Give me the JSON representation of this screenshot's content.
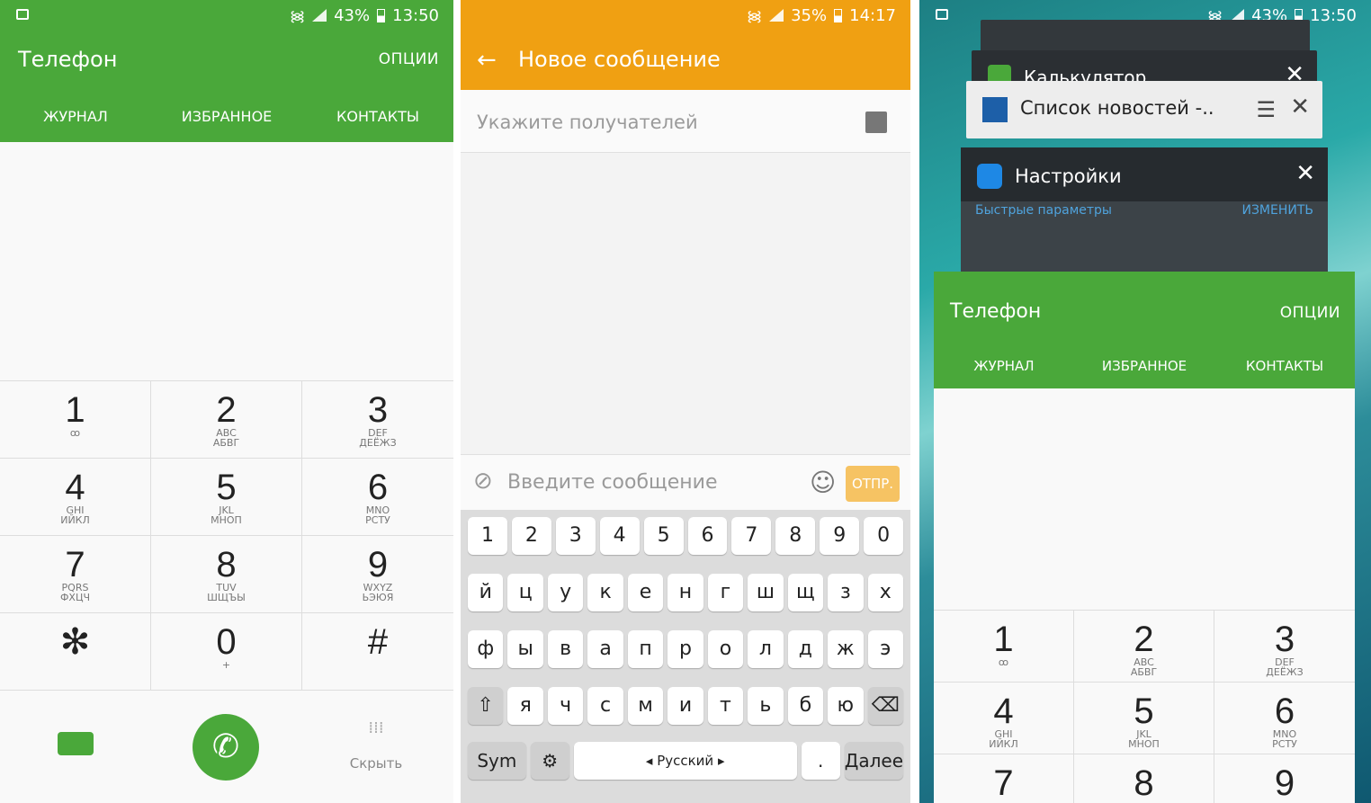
{
  "panel1": {
    "status": {
      "battery": "43%",
      "time": "13:50"
    },
    "title": "Телефон",
    "options": "ОПЦИИ",
    "tabs": [
      "ЖУРНАЛ",
      "ИЗБРАННОЕ",
      "КОНТАКТЫ"
    ],
    "keys": [
      {
        "d": "1",
        "l": "ꝏ"
      },
      {
        "d": "2",
        "l": "ABC\nАБВГ"
      },
      {
        "d": "3",
        "l": "DEF\nДЕЁЖЗ"
      },
      {
        "d": "4",
        "l": "GHI\nИЙКЛ"
      },
      {
        "d": "5",
        "l": "JKL\nМНОП"
      },
      {
        "d": "6",
        "l": "MNO\nРСТУ"
      },
      {
        "d": "7",
        "l": "PQRS\nФХЦЧ"
      },
      {
        "d": "8",
        "l": "TUV\nШЩЪЫ"
      },
      {
        "d": "9",
        "l": "WXYZ\nЬЭЮЯ"
      },
      {
        "d": "✻",
        "l": ""
      },
      {
        "d": "0",
        "l": "+"
      },
      {
        "d": "#",
        "l": ""
      }
    ],
    "hide_label": "Скрыть"
  },
  "panel2": {
    "status": {
      "battery": "35%",
      "time": "14:17"
    },
    "title": "Новое сообщение",
    "recipient_placeholder": "Укажите получателей",
    "message_placeholder": "Введите сообщение",
    "send": "ОТПР.",
    "rows": [
      [
        "1",
        "2",
        "3",
        "4",
        "5",
        "6",
        "7",
        "8",
        "9",
        "0"
      ],
      [
        "й",
        "ц",
        "у",
        "к",
        "е",
        "н",
        "г",
        "ш",
        "щ",
        "з",
        "х"
      ],
      [
        "ф",
        "ы",
        "в",
        "а",
        "п",
        "р",
        "о",
        "л",
        "д",
        "ж",
        "э"
      ],
      [
        "⇧",
        "я",
        "ч",
        "с",
        "м",
        "и",
        "т",
        "ь",
        "б",
        "ю",
        "⌫"
      ]
    ],
    "sym": "Sym",
    "lang": "◂ Русский ▸",
    "next": "Далее"
  },
  "panel3": {
    "status": {
      "battery": "43%",
      "time": "13:50"
    },
    "card_calc": "Калькулятор",
    "card_news": "Список новостей -..",
    "card_settings": "Настройки",
    "quick_params": "Быстрые параметры",
    "edit": "ИЗМЕНИТЬ",
    "title": "Телефон",
    "options": "ОПЦИИ",
    "tabs": [
      "ЖУРНАЛ",
      "ИЗБРАННОЕ",
      "КОНТАКТЫ"
    ],
    "keys": [
      {
        "d": "1",
        "l": "ꝏ"
      },
      {
        "d": "2",
        "l": "ABC\nАБВГ"
      },
      {
        "d": "3",
        "l": "DEF\nДЕЁЖЗ"
      },
      {
        "d": "4",
        "l": "GHI\nИЙКЛ"
      },
      {
        "d": "5",
        "l": "JKL\nМНОП"
      },
      {
        "d": "6",
        "l": "MNO\nРСТУ"
      },
      {
        "d": "7",
        "l": ""
      },
      {
        "d": "8",
        "l": ""
      },
      {
        "d": "9",
        "l": ""
      }
    ]
  }
}
